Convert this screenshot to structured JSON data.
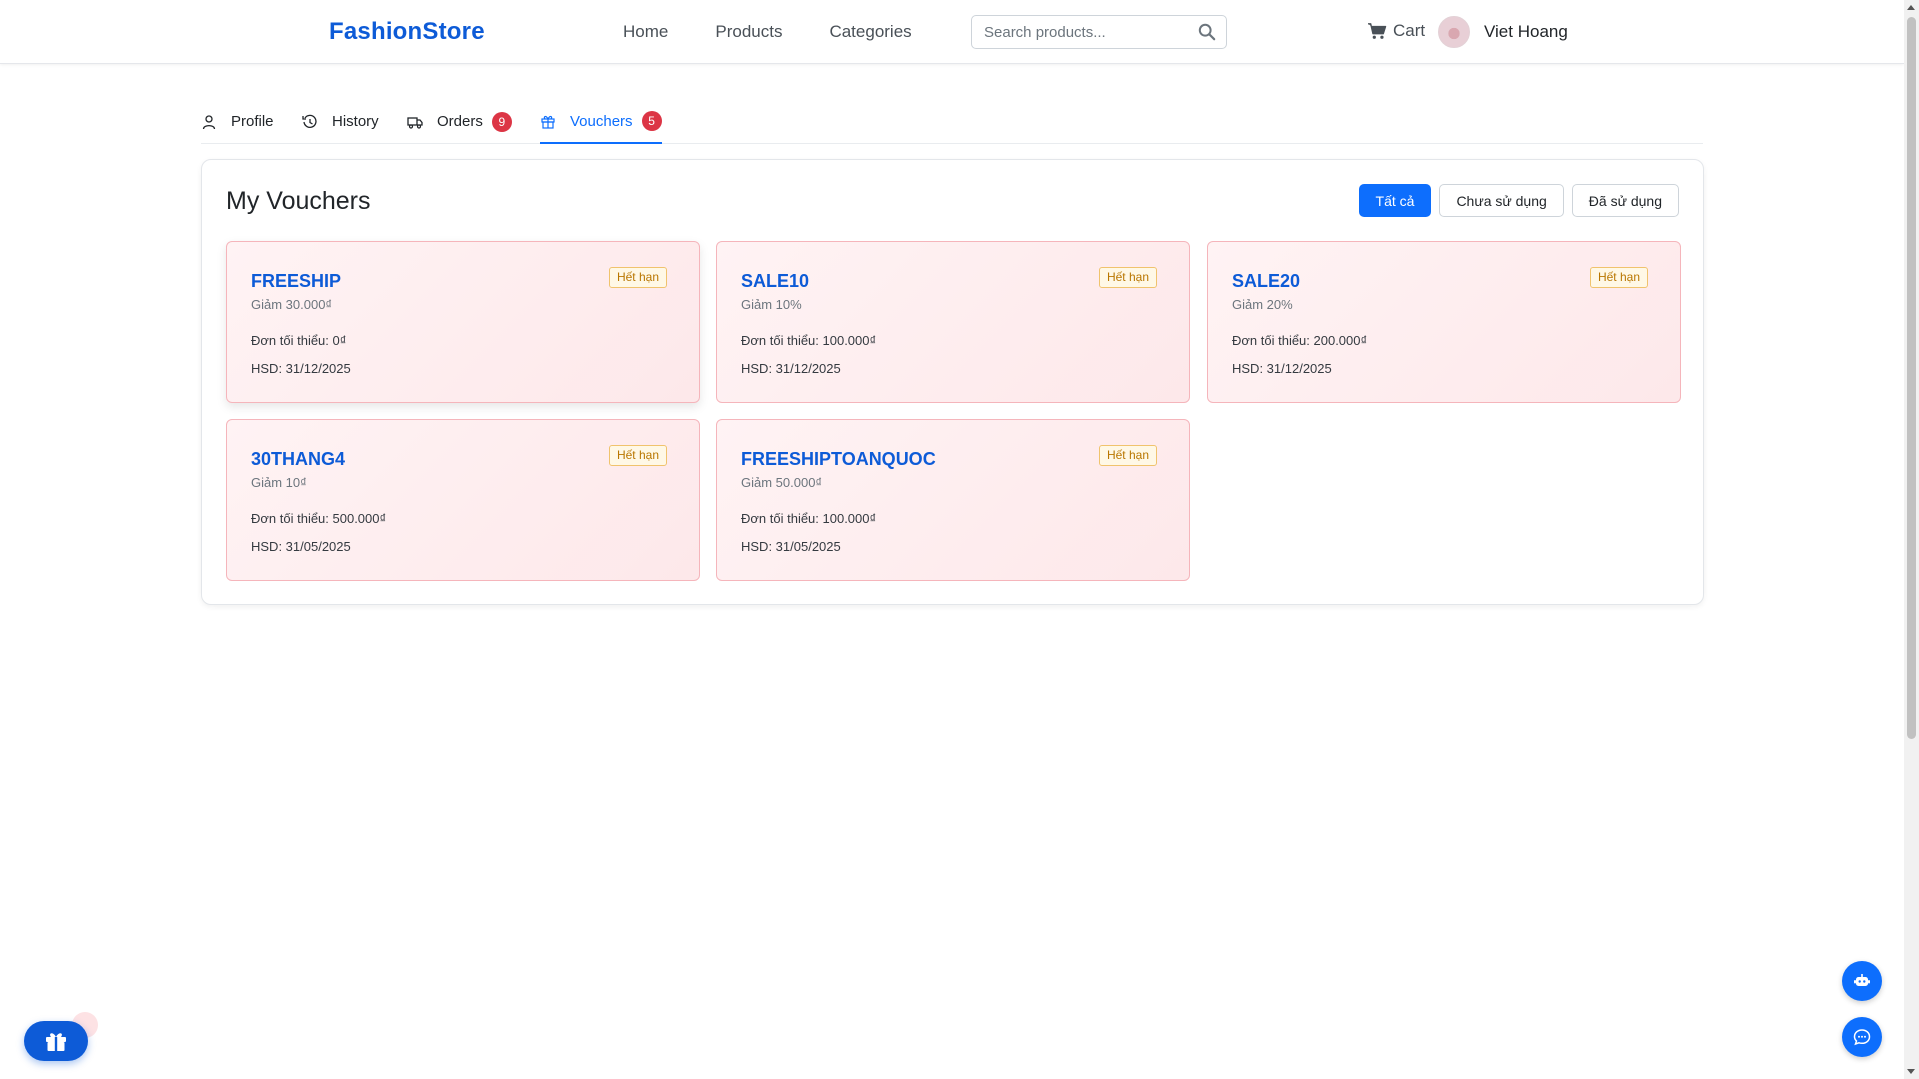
{
  "header": {
    "logo": "FashionStore",
    "nav": [
      "Home",
      "Products",
      "Categories"
    ],
    "search_placeholder": "Search products...",
    "cart_label": "Cart",
    "user_name": "Viet Hoang"
  },
  "tabs": [
    {
      "label": "Profile",
      "icon": "user-icon",
      "badge": null
    },
    {
      "label": "History",
      "icon": "history-icon",
      "badge": null
    },
    {
      "label": "Orders",
      "icon": "truck-icon",
      "badge": "9"
    },
    {
      "label": "Vouchers",
      "icon": "gift-icon",
      "badge": "5",
      "active": true
    }
  ],
  "vouchers_panel": {
    "title": "My Vouchers",
    "filters": [
      "Tất cả",
      "Chưa sử dụng",
      "Đã sử dụng"
    ],
    "active_filter": "Tất cả"
  },
  "vouchers": [
    {
      "code": "FREESHIP",
      "discount": "Giảm 30.000₫",
      "min_order": "Đơn tối thiểu: 0₫",
      "expiry": "HSD: 31/12/2025",
      "status": "Hết hạn"
    },
    {
      "code": "SALE10",
      "discount": "Giảm 10%",
      "min_order": "Đơn tối thiểu: 100.000₫",
      "expiry": "HSD: 31/12/2025",
      "status": "Hết hạn"
    },
    {
      "code": "SALE20",
      "discount": "Giảm 20%",
      "min_order": "Đơn tối thiểu: 200.000₫",
      "expiry": "HSD: 31/12/2025",
      "status": "Hết hạn"
    },
    {
      "code": "30THANG4",
      "discount": "Giảm 10₫",
      "min_order": "Đơn tối thiểu: 500.000₫",
      "expiry": "HSD: 31/05/2025",
      "status": "Hết hạn"
    },
    {
      "code": "FREESHIPTOANQUOC",
      "discount": "Giảm 50.000₫",
      "min_order": "Đơn tối thiểu: 100.000₫",
      "expiry": "HSD: 31/05/2025",
      "status": "Hết hạn"
    }
  ],
  "colors": {
    "brand": "#0d5bd7",
    "primary": "#0d6efd",
    "badge": "#dc3545",
    "voucher_bg": "#fde8ea",
    "status_expired": "#b97600"
  },
  "floating": {
    "gift_button_icon": "gift-icon",
    "bot_button_icon": "robot-icon",
    "chat_button_icon": "chat-icon"
  }
}
